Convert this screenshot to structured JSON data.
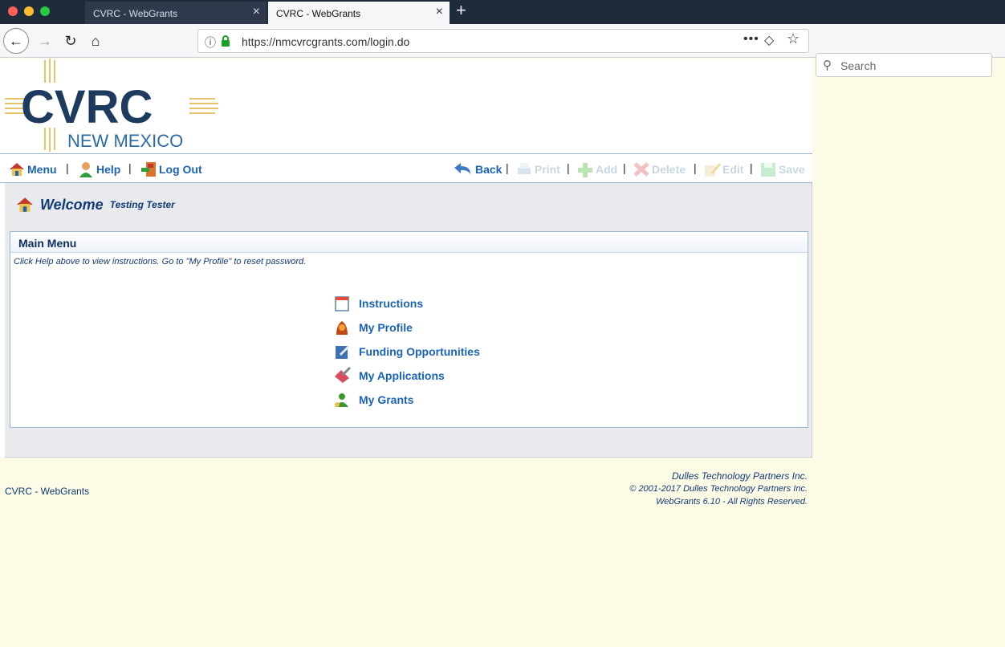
{
  "browser": {
    "tabs": [
      {
        "title": "CVRC - WebGrants",
        "active": false
      },
      {
        "title": "CVRC - WebGrants",
        "active": true
      }
    ],
    "url": "https://nmcvrcgrants.com/login.do",
    "search_placeholder": "Search"
  },
  "logo": {
    "main": "CVRC",
    "sub": "NEW MEXICO"
  },
  "toolbar": {
    "left": [
      {
        "label": "Menu",
        "icon": "house-icon"
      },
      {
        "label": "Help",
        "icon": "person-help-icon"
      },
      {
        "label": "Log Out",
        "icon": "logout-door-icon"
      }
    ],
    "right": [
      {
        "label": "Back",
        "icon": "back-arrow-icon",
        "enabled": true
      },
      {
        "label": "Print",
        "icon": "print-icon",
        "enabled": false
      },
      {
        "label": "Add",
        "icon": "add-icon",
        "enabled": false
      },
      {
        "label": "Delete",
        "icon": "delete-icon",
        "enabled": false
      },
      {
        "label": "Edit",
        "icon": "edit-icon",
        "enabled": false
      },
      {
        "label": "Save",
        "icon": "save-icon",
        "enabled": false
      }
    ],
    "separator": "|"
  },
  "welcome": {
    "word": "Welcome",
    "name": "Testing Tester"
  },
  "main_menu": {
    "title": "Main Menu",
    "help": "Click Help above to view instructions. Go to \"My Profile\" to reset password.",
    "items": [
      {
        "label": "Instructions",
        "icon": "calendar-icon"
      },
      {
        "label": "My Profile",
        "icon": "profile-icon"
      },
      {
        "label": "Funding Opportunities",
        "icon": "funding-icon"
      },
      {
        "label": "My Applications",
        "icon": "applications-icon"
      },
      {
        "label": "My Grants",
        "icon": "grants-icon"
      }
    ]
  },
  "footer": {
    "left": "CVRC - WebGrants",
    "company": "Dulles Technology Partners Inc.",
    "copyright": "© 2001-2017 Dulles Technology Partners Inc.",
    "version": "WebGrants 6.10 - All Rights Reserved."
  },
  "colors": {
    "link": "#1a63b8",
    "dark_blue": "#123a74",
    "logo_navy": "#1d3a5f",
    "logo_gold": "#e7c36a",
    "page_bg": "#fbfbe6"
  }
}
